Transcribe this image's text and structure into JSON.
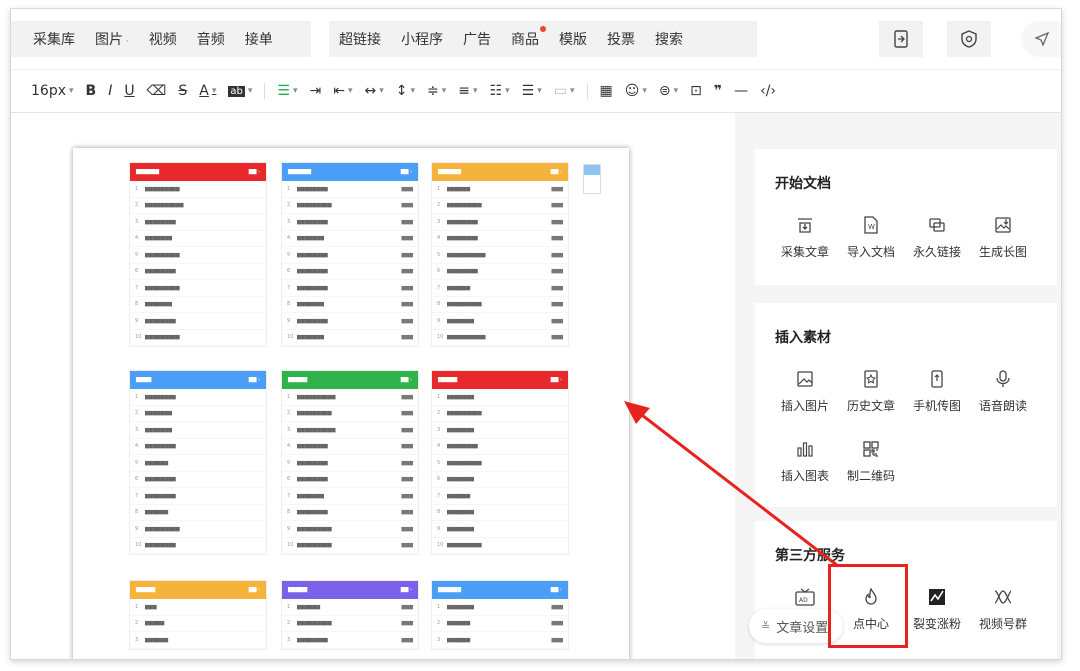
{
  "topnav": {
    "group1": [
      {
        "label": "采集库",
        "caret": false
      },
      {
        "label": "图片",
        "caret": true
      },
      {
        "label": "视频",
        "caret": false
      },
      {
        "label": "音频",
        "caret": false
      },
      {
        "label": "接单",
        "caret": false
      }
    ],
    "group2": [
      {
        "label": "超链接",
        "dot": false
      },
      {
        "label": "小程序",
        "dot": false
      },
      {
        "label": "广告",
        "dot": false
      },
      {
        "label": "商品",
        "dot": true
      },
      {
        "label": "模版",
        "dot": false
      },
      {
        "label": "投票",
        "dot": false
      },
      {
        "label": "搜索",
        "dot": false
      }
    ],
    "icons": [
      "import-doc-icon",
      "shield-icon",
      "navigation-icon"
    ]
  },
  "toolbar": {
    "font_size": "16px",
    "bold": "B",
    "italic": "I",
    "underline": "U",
    "strike": "S",
    "font_color": "A",
    "bg_color": "ab"
  },
  "doc_preview": {
    "cards": [
      {
        "color": "#e8282b",
        "rows": 10
      },
      {
        "color": "#4b9ef5",
        "rows": 10
      },
      {
        "color": "#f6b33b",
        "rows": 10
      },
      {
        "color": "#4b9ef5",
        "rows": 10
      },
      {
        "color": "#2fb34a",
        "rows": 10
      },
      {
        "color": "#e8282b",
        "rows": 10
      },
      {
        "color": "#f6b33b",
        "rows": 3
      },
      {
        "color": "#7b61e8",
        "rows": 3
      },
      {
        "color": "#4b9ef5",
        "rows": 3
      }
    ]
  },
  "right_panel": {
    "sections": [
      {
        "title": "开始文档",
        "items": [
          {
            "label": "采集文章",
            "icon": "collect-article-icon"
          },
          {
            "label": "导入文档",
            "icon": "import-word-icon"
          },
          {
            "label": "永久链接",
            "icon": "permanent-link-icon"
          },
          {
            "label": "生成长图",
            "icon": "long-image-icon"
          }
        ]
      },
      {
        "title": "插入素材",
        "items": [
          {
            "label": "插入图片",
            "icon": "image-icon"
          },
          {
            "label": "历史文章",
            "icon": "history-article-icon"
          },
          {
            "label": "手机传图",
            "icon": "phone-upload-icon"
          },
          {
            "label": "语音朗读",
            "icon": "microphone-icon"
          },
          {
            "label": "插入图表",
            "icon": "chart-icon"
          },
          {
            "label": "制二维码",
            "icon": "qrcode-icon"
          }
        ]
      },
      {
        "title": "第三方服务",
        "items": [
          {
            "label": "",
            "icon": "ad-tv-icon"
          },
          {
            "label": "点中心",
            "icon": "flame-icon"
          },
          {
            "label": "裂变涨粉",
            "icon": "fission-icon"
          },
          {
            "label": "视频号群",
            "icon": "video-channel-icon"
          }
        ]
      }
    ],
    "doc_settings": "文章设置"
  },
  "colors": {
    "highlight": "#e8231e",
    "accent_green": "#22aa44"
  }
}
